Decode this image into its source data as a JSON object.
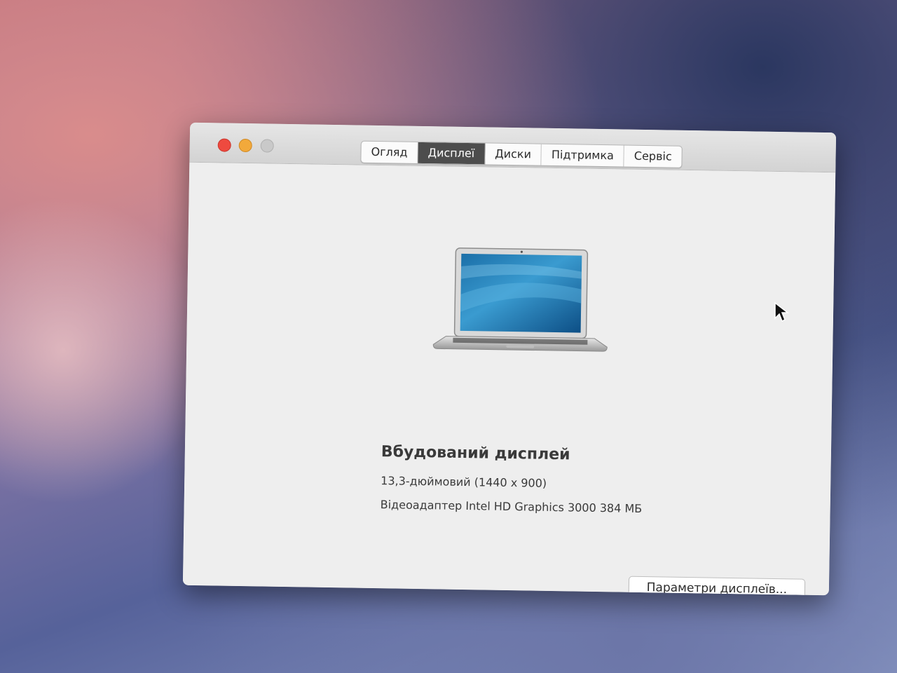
{
  "window": {
    "tabs": [
      {
        "label": "Огляд",
        "active": false
      },
      {
        "label": "Дисплеї",
        "active": true
      },
      {
        "label": "Диски",
        "active": false
      },
      {
        "label": "Підтримка",
        "active": false
      },
      {
        "label": "Сервіс",
        "active": false
      }
    ]
  },
  "display": {
    "name": "Вбудований дисплей",
    "size": "13,3-дюймовий (1440 x 900)",
    "graphics": "Відеоадаптер Intel HD Graphics 3000 384 МБ",
    "icon": "laptop-icon"
  },
  "buttons": {
    "display_settings": "Параметри дисплеїв..."
  },
  "colors": {
    "close": "#ee4a3f",
    "minimize": "#f2a93b",
    "zoom": "#c9c9c9",
    "active_tab": "#4d4d4d"
  }
}
